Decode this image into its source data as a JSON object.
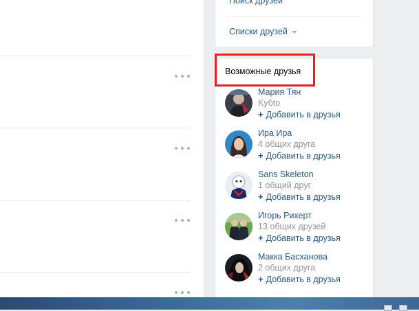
{
  "menu": {
    "search_friends": "Поиск друзей",
    "friend_lists": "Списки друзей"
  },
  "suggestions": {
    "title": "Возможные друзья",
    "add_label": "Добавить в друзья",
    "items": [
      {
        "name": "Мария Тян",
        "subtitle": "Kyбto"
      },
      {
        "name": "Ира Ира",
        "subtitle": "4 общих друга"
      },
      {
        "name": "Sans Skeleton",
        "subtitle": "1 общий друг"
      },
      {
        "name": "Игорь Рихерт",
        "subtitle": "13 общих друзей"
      },
      {
        "name": "Макка Басханова",
        "subtitle": "2 общих друга"
      }
    ]
  },
  "colors": {
    "link": "#2a5885",
    "muted": "#939393",
    "highlight": "#e0202a",
    "background": "#edeef0"
  },
  "icons": {
    "more": "more-dots-icon",
    "plus": "plus-icon",
    "caret": "caret-down-icon"
  }
}
